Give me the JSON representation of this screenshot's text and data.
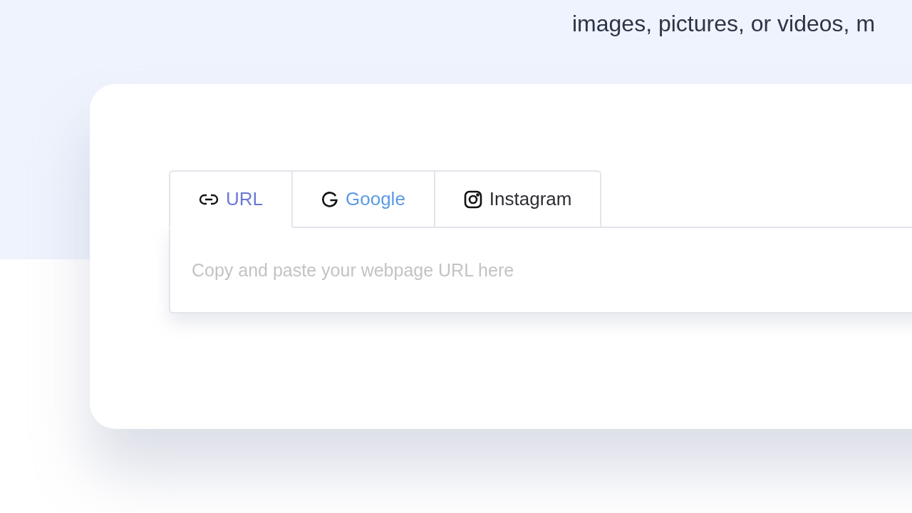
{
  "intro_text": "images, pictures, or videos, m",
  "tabs": [
    {
      "label": "URL",
      "kind": "link",
      "selected": true,
      "hovered": false
    },
    {
      "label": "Google",
      "kind": "google",
      "selected": false,
      "hovered": true
    },
    {
      "label": "Instagram",
      "kind": "instagram",
      "selected": false,
      "hovered": false
    }
  ],
  "url_field": {
    "placeholder": "Copy and paste your webpage URL here"
  }
}
